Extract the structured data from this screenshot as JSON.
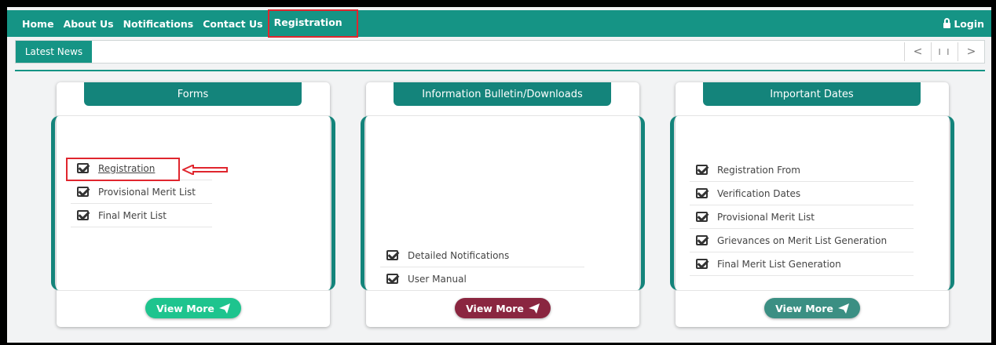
{
  "nav": {
    "items": [
      "Home",
      "About Us",
      "Notifications",
      "Contact Us",
      "Registration"
    ],
    "login": "Login"
  },
  "news": {
    "label": "Latest News",
    "controls": [
      "<",
      "I I",
      ">"
    ]
  },
  "panels": [
    {
      "title": "Forms",
      "items": [
        "Registration",
        "Provisional Merit List",
        "Final Merit List"
      ],
      "button": "View More"
    },
    {
      "title": "Information Bulletin/Downloads",
      "items": [
        "Detailed Notifications",
        "User Manual"
      ],
      "button": "View More"
    },
    {
      "title": "Important Dates",
      "items": [
        "Registration From",
        "Verification Dates",
        "Provisional Merit List",
        "Grievances on Merit List Generation",
        "Final Merit List Generation"
      ],
      "button": "View More"
    }
  ],
  "colors": {
    "primary": "#159485",
    "highlight": "#e0262e",
    "btn_green": "#1ec48e",
    "btn_maroon": "#8a2640",
    "btn_teal": "#3b8f83"
  }
}
